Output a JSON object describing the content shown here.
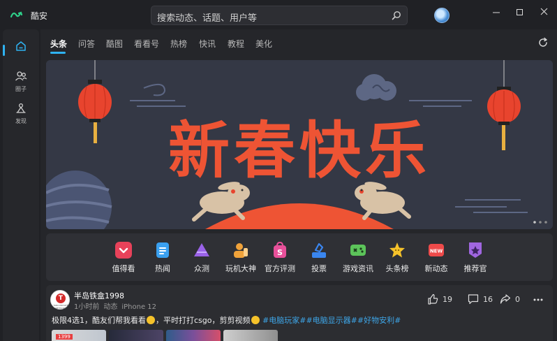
{
  "app": {
    "title": "酷安",
    "accent": "#2fb3f2"
  },
  "search": {
    "placeholder": "搜索动态、话题、用户等"
  },
  "sidebar": {
    "items": [
      {
        "label": "",
        "icon": "home-icon",
        "active": true
      },
      {
        "label": "圈子",
        "icon": "group-icon"
      },
      {
        "label": "发现",
        "icon": "discover-icon"
      }
    ]
  },
  "tabs": [
    "头条",
    "问答",
    "酷图",
    "看看号",
    "热榜",
    "快讯",
    "教程",
    "美化"
  ],
  "banner": {
    "headline": "新春快乐"
  },
  "shortcuts": [
    {
      "label": "值得看",
      "icon": "heart-icon",
      "color": "#e8425a"
    },
    {
      "label": "热闻",
      "icon": "news-icon",
      "color": "#3aa0f0"
    },
    {
      "label": "众测",
      "icon": "triangle-icon",
      "color": "#9a62e8"
    },
    {
      "label": "玩机大神",
      "icon": "person-icon",
      "color": "#f0a23a"
    },
    {
      "label": "官方评测",
      "icon": "shop-bag-icon",
      "color": "#e8509a"
    },
    {
      "label": "投票",
      "icon": "vote-icon",
      "color": "#3a86f0"
    },
    {
      "label": "游戏资讯",
      "icon": "gamepad-icon",
      "color": "#5cc45a"
    },
    {
      "label": "头条榜",
      "icon": "star-icon",
      "color": "#f5c22a"
    },
    {
      "label": "新动态",
      "icon": "new-icon",
      "color": "#ee4a4a"
    },
    {
      "label": "推荐官",
      "icon": "badge-icon",
      "color": "#a066e0"
    }
  ],
  "post": {
    "author": "半岛铁盒1998",
    "avatar_letter": "T",
    "avatar_caption": "TARO PRIVATE NETWORK",
    "time": "1小时前",
    "type": "动态",
    "device": "iPhone 12",
    "likes": "19",
    "comments": "16",
    "shares": "0",
    "text_a": "极限4选1，酷友们帮我看看",
    "text_b": "，平时打打csgo，剪剪视频",
    "tags": [
      "#电脑玩家#",
      "#电脑显示器#",
      "#好物安利#"
    ],
    "thumb_caption": "1399"
  }
}
